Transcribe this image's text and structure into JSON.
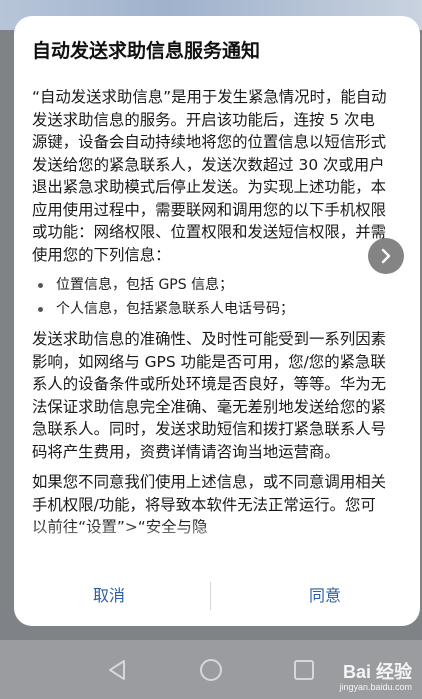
{
  "dialog": {
    "title": "自动发送求助信息服务通知",
    "paragraph1": "“自动发送求助信息”是用于发生紧急情况时，能自动发送求助信息的服务。开启该功能后，连按 5 次电源键，设备会自动持续地将您的位置信息以短信形式发送给您的紧急联系人，发送次数超过 30 次或用户退出紧急求助模式后停止发送。为实现上述功能，本应用使用过程中，需要联网和调用您的以下手机权限或功能：网络权限、位置权限和发送短信权限，并需使用您的下列信息：",
    "bullets": [
      "位置信息，包括 GPS 信息；",
      "个人信息，包括紧急联系人电话号码；"
    ],
    "paragraph2": "发送求助信息的准确性、及时性可能受到一系列因素影响，如网络与 GPS 功能是否可用，您/您的紧急联系人的设备条件或所处环境是否良好，等等。华为无法保证求助信息完全准确、毫无差别地发送给您的紧急联系人。同时，发送求助短信和拨打紧急联系人号码将产生费用，资费详情请咨询当地运营商。",
    "paragraph3": "如果您不同意我们使用上述信息，或不同意调用相关手机权限/功能，将导致本软件无法正常运行。您可以前往“设置”>“安全与隐",
    "cancel_label": "取消",
    "agree_label": "同意"
  },
  "watermark": {
    "brand": "Bai  经验",
    "url": "jingyan.baidu.com"
  },
  "colors": {
    "accent": "#2a5fa6",
    "dialog_bg": "#ffffff",
    "scrim": "#7f8286"
  }
}
